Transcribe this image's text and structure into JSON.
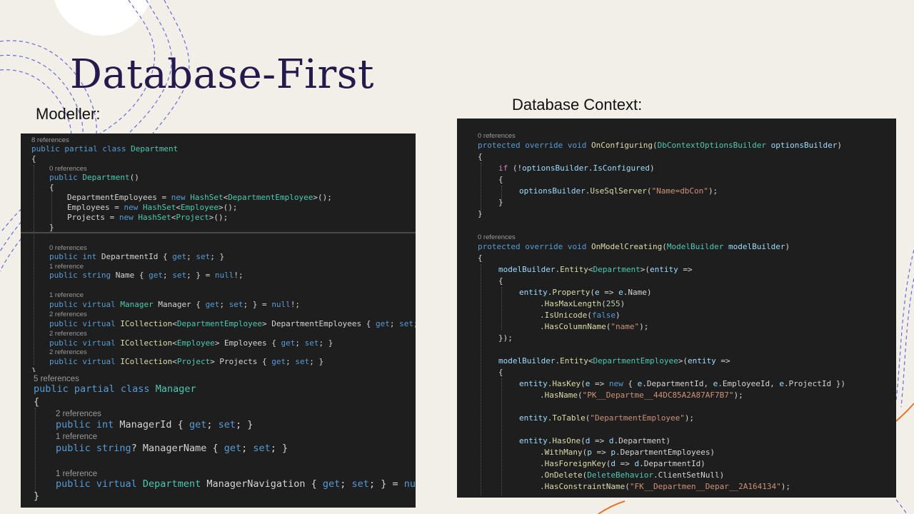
{
  "slide": {
    "title": "Database-First",
    "models_label": "Modeller:",
    "context_label": "Database Context:"
  },
  "department_code": {
    "lines": [
      {
        "ref": true,
        "tokens": [
          [
            "c",
            "8 references"
          ]
        ]
      },
      {
        "tokens": [
          [
            "k",
            "public partial class "
          ],
          [
            "t",
            "Department"
          ]
        ]
      },
      {
        "tokens": [
          [
            "p",
            "{"
          ]
        ]
      },
      {
        "ref": true,
        "tokens": [
          [
            "c",
            "0 references"
          ]
        ]
      },
      {
        "tokens": [
          [
            "k",
            "public "
          ],
          [
            "t",
            "Department"
          ],
          [
            "p",
            "()"
          ]
        ]
      },
      {
        "tokens": [
          [
            "p",
            "{"
          ]
        ]
      },
      {
        "tokens": [
          [
            "p",
            "DepartmentEmployees = "
          ],
          [
            "k",
            "new "
          ],
          [
            "t",
            "HashSet"
          ],
          [
            "p",
            "<"
          ],
          [
            "t",
            "DepartmentEmployee"
          ],
          [
            "p",
            ">();"
          ]
        ]
      },
      {
        "tokens": [
          [
            "p",
            "Employees = "
          ],
          [
            "k",
            "new "
          ],
          [
            "t",
            "HashSet"
          ],
          [
            "p",
            "<"
          ],
          [
            "t",
            "Employee"
          ],
          [
            "p",
            ">();"
          ]
        ]
      },
      {
        "tokens": [
          [
            "p",
            "Projects = "
          ],
          [
            "k",
            "new "
          ],
          [
            "t",
            "HashSet"
          ],
          [
            "p",
            "<"
          ],
          [
            "t",
            "Project"
          ],
          [
            "p",
            ">();"
          ]
        ]
      },
      {
        "tokens": [
          [
            "p",
            "}"
          ]
        ]
      },
      {
        "ref": true,
        "tokens": [
          [
            "c",
            "0 references"
          ]
        ]
      },
      {
        "tokens": [
          [
            "k",
            "public int "
          ],
          [
            "p",
            "DepartmentId { "
          ],
          [
            "k",
            "get"
          ],
          [
            "p",
            "; "
          ],
          [
            "k",
            "set"
          ],
          [
            "p",
            "; }"
          ]
        ]
      },
      {
        "ref": true,
        "tokens": [
          [
            "c",
            "1 reference"
          ]
        ]
      },
      {
        "tokens": [
          [
            "k",
            "public string "
          ],
          [
            "p",
            "Name { "
          ],
          [
            "k",
            "get"
          ],
          [
            "p",
            "; "
          ],
          [
            "k",
            "set"
          ],
          [
            "p",
            "; } = "
          ],
          [
            "k",
            "null"
          ],
          [
            "p",
            "!;"
          ]
        ]
      },
      {
        "ref": true,
        "tokens": [
          [
            "c",
            "1 reference"
          ]
        ]
      },
      {
        "tokens": [
          [
            "k",
            "public virtual "
          ],
          [
            "t",
            "Manager"
          ],
          [
            "p",
            " Manager { "
          ],
          [
            "k",
            "get"
          ],
          [
            "p",
            "; "
          ],
          [
            "k",
            "set"
          ],
          [
            "p",
            "; } = "
          ],
          [
            "k",
            "null"
          ],
          [
            "p",
            "!;"
          ]
        ]
      },
      {
        "ref": true,
        "tokens": [
          [
            "c",
            "2 references"
          ]
        ]
      },
      {
        "tokens": [
          [
            "k",
            "public virtual "
          ],
          [
            "f",
            "ICollection"
          ],
          [
            "p",
            "<"
          ],
          [
            "t",
            "DepartmentEmployee"
          ],
          [
            "p",
            "> DepartmentEmployees { "
          ],
          [
            "k",
            "get"
          ],
          [
            "p",
            "; "
          ],
          [
            "k",
            "set"
          ],
          [
            "p",
            "; }"
          ]
        ]
      },
      {
        "ref": true,
        "tokens": [
          [
            "c",
            "2 references"
          ]
        ]
      },
      {
        "tokens": [
          [
            "k",
            "public virtual "
          ],
          [
            "f",
            "ICollection"
          ],
          [
            "p",
            "<"
          ],
          [
            "t",
            "Employee"
          ],
          [
            "p",
            "> Employees { "
          ],
          [
            "k",
            "get"
          ],
          [
            "p",
            "; "
          ],
          [
            "k",
            "set"
          ],
          [
            "p",
            "; }"
          ]
        ]
      },
      {
        "ref": true,
        "tokens": [
          [
            "c",
            "2 references"
          ]
        ]
      },
      {
        "tokens": [
          [
            "k",
            "public virtual "
          ],
          [
            "f",
            "ICollection"
          ],
          [
            "p",
            "<"
          ],
          [
            "t",
            "Project"
          ],
          [
            "p",
            "> Projects { "
          ],
          [
            "k",
            "get"
          ],
          [
            "p",
            "; "
          ],
          [
            "k",
            "set"
          ],
          [
            "p",
            "; }"
          ]
        ]
      },
      {
        "tokens": [
          [
            "p",
            "}"
          ]
        ]
      }
    ]
  },
  "manager_code": {
    "lines": [
      {
        "ref": true,
        "tokens": [
          [
            "c",
            "5 references"
          ]
        ]
      },
      {
        "tokens": [
          [
            "k",
            "public partial class "
          ],
          [
            "t",
            "Manager"
          ]
        ]
      },
      {
        "tokens": [
          [
            "p",
            "{"
          ]
        ]
      },
      {
        "ref": true,
        "tokens": [
          [
            "c",
            "2 references"
          ]
        ]
      },
      {
        "tokens": [
          [
            "k",
            "public int "
          ],
          [
            "p",
            "ManagerId { "
          ],
          [
            "k",
            "get"
          ],
          [
            "p",
            "; "
          ],
          [
            "k",
            "set"
          ],
          [
            "p",
            "; }"
          ]
        ]
      },
      {
        "ref": true,
        "tokens": [
          [
            "c",
            "1 reference"
          ]
        ]
      },
      {
        "tokens": [
          [
            "k",
            "public string"
          ],
          [
            "p",
            "? ManagerName { "
          ],
          [
            "k",
            "get"
          ],
          [
            "p",
            "; "
          ],
          [
            "k",
            "set"
          ],
          [
            "p",
            "; }"
          ]
        ]
      },
      {
        "ref": true,
        "tokens": [
          [
            "c",
            "1 reference"
          ]
        ]
      },
      {
        "tokens": [
          [
            "k",
            "public virtual "
          ],
          [
            "t",
            "Department"
          ],
          [
            "p",
            " ManagerNavigation { "
          ],
          [
            "k",
            "get"
          ],
          [
            "p",
            "; "
          ],
          [
            "k",
            "set"
          ],
          [
            "p",
            "; } = "
          ],
          [
            "k",
            "null"
          ],
          [
            "p",
            "!;"
          ]
        ]
      },
      {
        "tokens": [
          [
            "p",
            "}"
          ]
        ]
      }
    ]
  },
  "context_code": {
    "lines": [
      {
        "ref": true,
        "tokens": [
          [
            "c",
            "0 references"
          ]
        ]
      },
      {
        "tokens": [
          [
            "k",
            "protected override void "
          ],
          [
            "f",
            "OnConfiguring"
          ],
          [
            "p",
            "("
          ],
          [
            "t",
            "DbContextOptionsBuilder"
          ],
          [
            "p",
            " "
          ],
          [
            "v",
            "optionsBuilder"
          ],
          [
            "p",
            ")"
          ]
        ]
      },
      {
        "tokens": [
          [
            "p",
            "{"
          ]
        ]
      },
      {
        "tokens": [
          [
            "m",
            "if "
          ],
          [
            "p",
            "(!"
          ],
          [
            "v",
            "optionsBuilder"
          ],
          [
            "p",
            "."
          ],
          [
            "v",
            "IsConfigured"
          ],
          [
            "p",
            ")"
          ]
        ]
      },
      {
        "tokens": [
          [
            "p",
            "{"
          ]
        ]
      },
      {
        "tokens": [
          [
            "v",
            "optionsBuilder"
          ],
          [
            "p",
            "."
          ],
          [
            "f",
            "UseSqlServer"
          ],
          [
            "p",
            "("
          ],
          [
            "s",
            "\"Name=dbCon\""
          ],
          [
            "p",
            ");"
          ]
        ]
      },
      {
        "tokens": [
          [
            "p",
            "}"
          ]
        ]
      },
      {
        "tokens": [
          [
            "p",
            "}"
          ]
        ]
      },
      {
        "ref": true,
        "tokens": [
          [
            "c",
            "0 references"
          ]
        ]
      },
      {
        "tokens": [
          [
            "k",
            "protected override void "
          ],
          [
            "f",
            "OnModelCreating"
          ],
          [
            "p",
            "("
          ],
          [
            "t",
            "ModelBuilder"
          ],
          [
            "p",
            " "
          ],
          [
            "v",
            "modelBuilder"
          ],
          [
            "p",
            ")"
          ]
        ]
      },
      {
        "tokens": [
          [
            "p",
            "{"
          ]
        ]
      },
      {
        "tokens": [
          [
            "v",
            "modelBuilder"
          ],
          [
            "p",
            "."
          ],
          [
            "f",
            "Entity"
          ],
          [
            "p",
            "<"
          ],
          [
            "t",
            "Department"
          ],
          [
            "p",
            ">("
          ],
          [
            "v",
            "entity"
          ],
          [
            "p",
            " =>"
          ]
        ]
      },
      {
        "tokens": [
          [
            "p",
            "{"
          ]
        ]
      },
      {
        "tokens": [
          [
            "v",
            "entity"
          ],
          [
            "p",
            "."
          ],
          [
            "f",
            "Property"
          ],
          [
            "p",
            "("
          ],
          [
            "v",
            "e"
          ],
          [
            "p",
            " => "
          ],
          [
            "v",
            "e"
          ],
          [
            "p",
            ".Name)"
          ]
        ]
      },
      {
        "tokens": [
          [
            "p",
            "."
          ],
          [
            "f",
            "HasMaxLength"
          ],
          [
            "p",
            "("
          ],
          [
            "n",
            "255"
          ],
          [
            "p",
            ")"
          ]
        ]
      },
      {
        "tokens": [
          [
            "p",
            "."
          ],
          [
            "f",
            "IsUnicode"
          ],
          [
            "p",
            "("
          ],
          [
            "k",
            "false"
          ],
          [
            "p",
            ")"
          ]
        ]
      },
      {
        "tokens": [
          [
            "p",
            "."
          ],
          [
            "f",
            "HasColumnName"
          ],
          [
            "p",
            "("
          ],
          [
            "s",
            "\"name\""
          ],
          [
            "p",
            ");"
          ]
        ]
      },
      {
        "tokens": [
          [
            "p",
            "});"
          ]
        ]
      },
      {
        "tokens": [
          [
            "v",
            "modelBuilder"
          ],
          [
            "p",
            "."
          ],
          [
            "f",
            "Entity"
          ],
          [
            "p",
            "<"
          ],
          [
            "t",
            "DepartmentEmployee"
          ],
          [
            "p",
            ">("
          ],
          [
            "v",
            "entity"
          ],
          [
            "p",
            " =>"
          ]
        ]
      },
      {
        "tokens": [
          [
            "p",
            "{"
          ]
        ]
      },
      {
        "tokens": [
          [
            "v",
            "entity"
          ],
          [
            "p",
            "."
          ],
          [
            "f",
            "HasKey"
          ],
          [
            "p",
            "("
          ],
          [
            "v",
            "e"
          ],
          [
            "p",
            " => "
          ],
          [
            "k",
            "new"
          ],
          [
            "p",
            " { "
          ],
          [
            "v",
            "e"
          ],
          [
            "p",
            ".DepartmentId, "
          ],
          [
            "v",
            "e"
          ],
          [
            "p",
            ".EmployeeId, "
          ],
          [
            "v",
            "e"
          ],
          [
            "p",
            ".ProjectId })"
          ]
        ]
      },
      {
        "tokens": [
          [
            "p",
            "."
          ],
          [
            "f",
            "HasName"
          ],
          [
            "p",
            "("
          ],
          [
            "s",
            "\"PK__Departme__44DC85A2A87AF7B7\""
          ],
          [
            "p",
            ");"
          ]
        ]
      },
      {
        "tokens": [
          [
            "v",
            "entity"
          ],
          [
            "p",
            "."
          ],
          [
            "f",
            "ToTable"
          ],
          [
            "p",
            "("
          ],
          [
            "s",
            "\"DepartmentEmployee\""
          ],
          [
            "p",
            ");"
          ]
        ]
      },
      {
        "tokens": [
          [
            "v",
            "entity"
          ],
          [
            "p",
            "."
          ],
          [
            "f",
            "HasOne"
          ],
          [
            "p",
            "("
          ],
          [
            "v",
            "d"
          ],
          [
            "p",
            " => "
          ],
          [
            "v",
            "d"
          ],
          [
            "p",
            ".Department)"
          ]
        ]
      },
      {
        "tokens": [
          [
            "p",
            "."
          ],
          [
            "f",
            "WithMany"
          ],
          [
            "p",
            "("
          ],
          [
            "v",
            "p"
          ],
          [
            "p",
            " => "
          ],
          [
            "v",
            "p"
          ],
          [
            "p",
            ".DepartmentEmployees)"
          ]
        ]
      },
      {
        "tokens": [
          [
            "p",
            "."
          ],
          [
            "f",
            "HasForeignKey"
          ],
          [
            "p",
            "("
          ],
          [
            "v",
            "d"
          ],
          [
            "p",
            " => "
          ],
          [
            "v",
            "d"
          ],
          [
            "p",
            ".DepartmentId)"
          ]
        ]
      },
      {
        "tokens": [
          [
            "p",
            "."
          ],
          [
            "f",
            "OnDelete"
          ],
          [
            "p",
            "("
          ],
          [
            "t",
            "DeleteBehavior"
          ],
          [
            "p",
            ".ClientSetNull)"
          ]
        ]
      },
      {
        "tokens": [
          [
            "p",
            "."
          ],
          [
            "f",
            "HasConstraintName"
          ],
          [
            "p",
            "("
          ],
          [
            "s",
            "\"FK__Departmen__Depar__2A164134\""
          ],
          [
            "p",
            ");"
          ]
        ]
      }
    ]
  }
}
